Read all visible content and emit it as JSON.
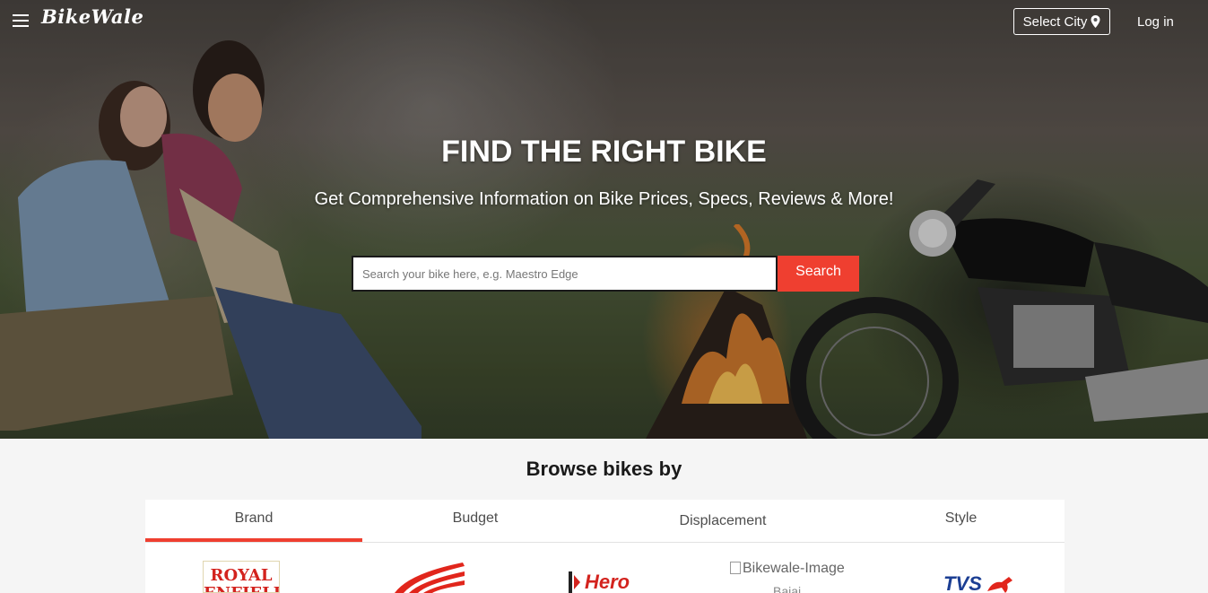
{
  "header": {
    "logo_text": "BikeWale",
    "select_city_label": "Select City",
    "login_label": "Log in"
  },
  "hero": {
    "title": "FIND THE RIGHT BIKE",
    "subtitle": "Get Comprehensive Information on Bike Prices, Specs, Reviews & More!",
    "search_placeholder": "Search your bike here, e.g. Maestro Edge",
    "search_value": "",
    "search_button": "Search"
  },
  "browse": {
    "title": "Browse bikes by",
    "tabs": [
      {
        "label": "Brand",
        "active": true
      },
      {
        "label": "Budget",
        "active": false
      },
      {
        "label": "Displacement",
        "active": false
      },
      {
        "label": "Style",
        "active": false
      }
    ],
    "brands": [
      {
        "name": "Royal Enfield",
        "logo_text": "ROYAL ENFIELD"
      },
      {
        "name": "Honda",
        "logo_text": ""
      },
      {
        "name": "Hero",
        "logo_text": "Hero"
      },
      {
        "name": "Bajaj",
        "image_alt": "Bikewale-Image",
        "caption": "Bajaj"
      },
      {
        "name": "TVS",
        "logo_text": "TVS"
      }
    ]
  },
  "colors": {
    "accent": "#ef3f30",
    "royal_enfield_red": "#d3231e",
    "tvs_blue": "#1b3e93"
  }
}
